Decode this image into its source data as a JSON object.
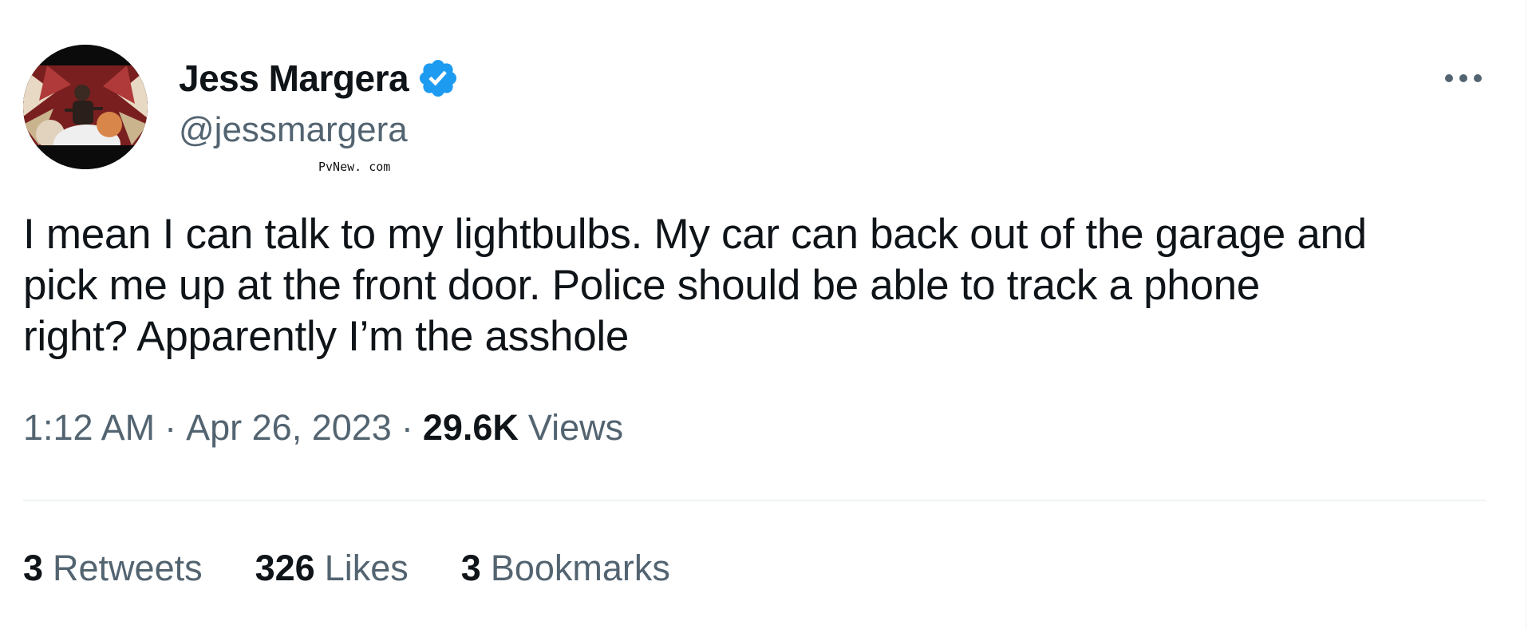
{
  "author": {
    "display_name": "Jess Margera",
    "handle": "@jessmargera",
    "verified_icon": "verified-badge-icon",
    "verified_color": "#1d9bf0"
  },
  "watermark": "PvNew. com",
  "tweet": {
    "lines": [
      "I mean I can talk to my lightbulbs. My car can back out of the garage and",
      "pick me up at the front door. Police should be able to track a phone",
      "right? Apparently I’m the asshole"
    ]
  },
  "meta": {
    "time": "1:12 AM",
    "separator": "·",
    "date": "Apr 26, 2023",
    "views_count": "29.6K",
    "views_label": "Views"
  },
  "stats": {
    "retweets_count": "3",
    "retweets_label": "Retweets",
    "likes_count": "326",
    "likes_label": "Likes",
    "bookmarks_count": "3",
    "bookmarks_label": "Bookmarks"
  },
  "colors": {
    "text_primary": "#0f1419",
    "text_secondary": "#536471",
    "divider": "#eff3f4"
  }
}
